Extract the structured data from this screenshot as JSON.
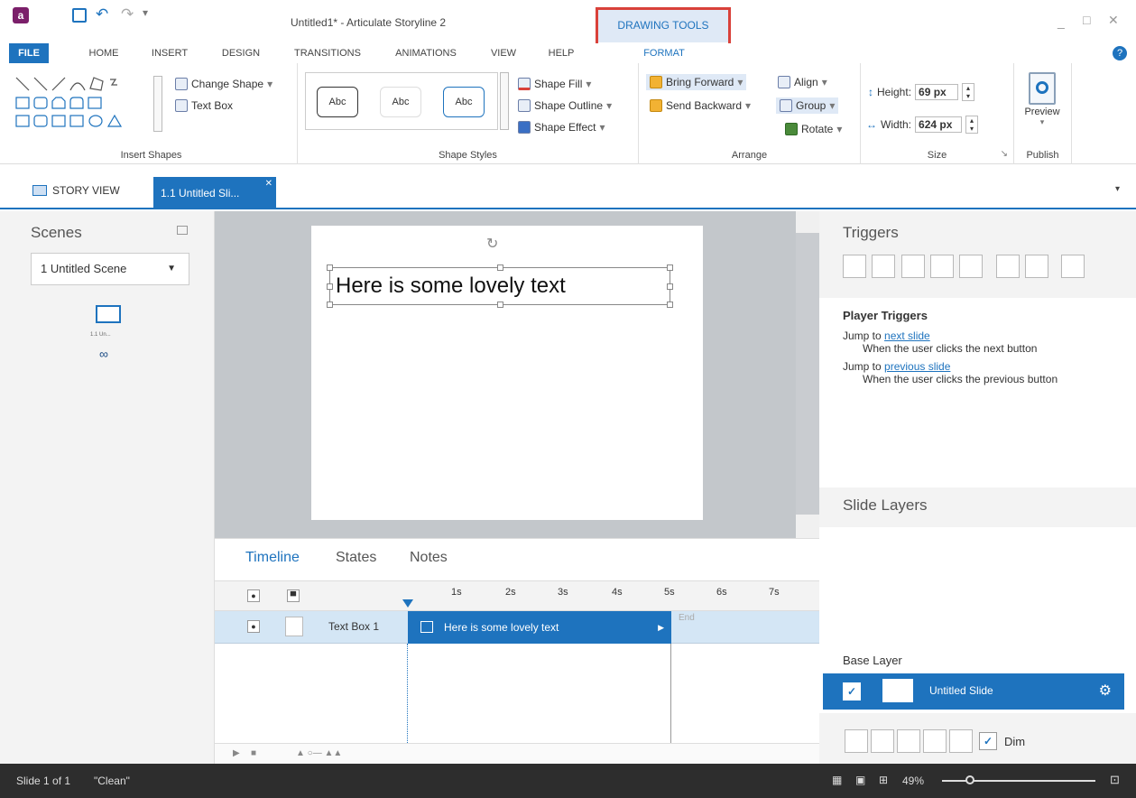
{
  "window": {
    "title": "Untitled1* - Articulate Storyline 2",
    "context_group": "DRAWING TOOLS"
  },
  "tabs": [
    "FILE",
    "HOME",
    "INSERT",
    "DESIGN",
    "TRANSITIONS",
    "ANIMATIONS",
    "VIEW",
    "HELP",
    "FORMAT"
  ],
  "ribbon": {
    "insert_shapes": {
      "change_shape": "Change Shape",
      "text_box": "Text Box",
      "label": "Insert Shapes"
    },
    "shape_styles": {
      "samples": [
        "Abc",
        "Abc",
        "Abc"
      ],
      "fill": "Shape Fill",
      "outline": "Shape Outline",
      "effect": "Shape Effect",
      "label": "Shape Styles"
    },
    "arrange": {
      "bring_forward": "Bring Forward",
      "send_backward": "Send Backward",
      "align": "Align",
      "group": "Group",
      "rotate": "Rotate",
      "label": "Arrange"
    },
    "size": {
      "height_label": "Height:",
      "height_value": "69 px",
      "width_label": "Width:",
      "width_value": "624 px",
      "label": "Size"
    },
    "publish": {
      "preview": "Preview",
      "label": "Publish"
    }
  },
  "doc_tabs": {
    "story_view": "STORY VIEW",
    "slide_tab": "1.1 Untitled Sli..."
  },
  "scenes": {
    "title": "Scenes",
    "dropdown": "1 Untitled Scene",
    "thumb_label": "1.1 Un..."
  },
  "slide": {
    "text": "Here is some lovely text"
  },
  "timeline": {
    "tabs": [
      "Timeline",
      "States",
      "Notes"
    ],
    "ticks": [
      "1s",
      "2s",
      "3s",
      "4s",
      "5s",
      "6s",
      "7s"
    ],
    "row_name": "Text Box 1",
    "bar_text": "Here is some lovely text",
    "end_label": "End"
  },
  "triggers": {
    "title": "Triggers",
    "section": "Player Triggers",
    "items": [
      {
        "prefix": "Jump to ",
        "link": "next slide",
        "desc": "When the user clicks the next button"
      },
      {
        "prefix": "Jump to ",
        "link": "previous slide",
        "desc": "When the user clicks the previous button"
      }
    ]
  },
  "layers": {
    "title": "Slide Layers",
    "base_label": "Base Layer",
    "slide_name": "Untitled Slide",
    "dim": "Dim"
  },
  "status": {
    "slide": "Slide 1 of 1",
    "theme": "\"Clean\"",
    "zoom": "49%"
  },
  "colors": {
    "accent": "#1e73be",
    "highlight": "#d9413a",
    "statusbar": "#2d2d2d"
  }
}
